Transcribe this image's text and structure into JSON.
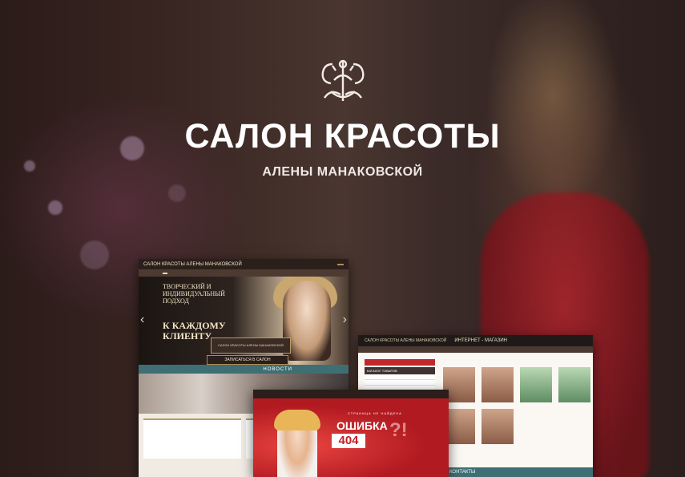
{
  "hero": {
    "title": "САЛОН КРАСОТЫ",
    "subtitle": "АЛЕНЫ МАНАКОВСКОЙ"
  },
  "shot_main": {
    "brand": "САЛОН КРАСОТЫ  АЛЕНЫ МАНАКОВСКОЙ",
    "hero_text_small": "ТВОРЧЕСКИЙ И ИНДИВИДУАЛЬНЫЙ ПОДХОД",
    "hero_text_big": "К КАЖДОМУ КЛИЕНТУ",
    "sign_text": "САЛОН КРАСОТЫ АЛЕНЫ МАНАКОВСКОЙ",
    "cta_label": "ЗАПИСАТЬСЯ В САЛОН",
    "news_label": "НОВОСТИ"
  },
  "shot_shop": {
    "brand": "САЛОН КРАСОТЫ АЛЕНЫ МАНАКОВСКОЙ",
    "section": "ИНТЕРНЕТ - МАГАЗИН",
    "catalog": "КАТАЛОГ ТОВАРОВ",
    "contacts": "КОНТАКТЫ"
  },
  "shot_404": {
    "label": "СТРАНИЦА НЕ НАЙДЕНА",
    "title": "ОШИБКА",
    "code": "404"
  }
}
